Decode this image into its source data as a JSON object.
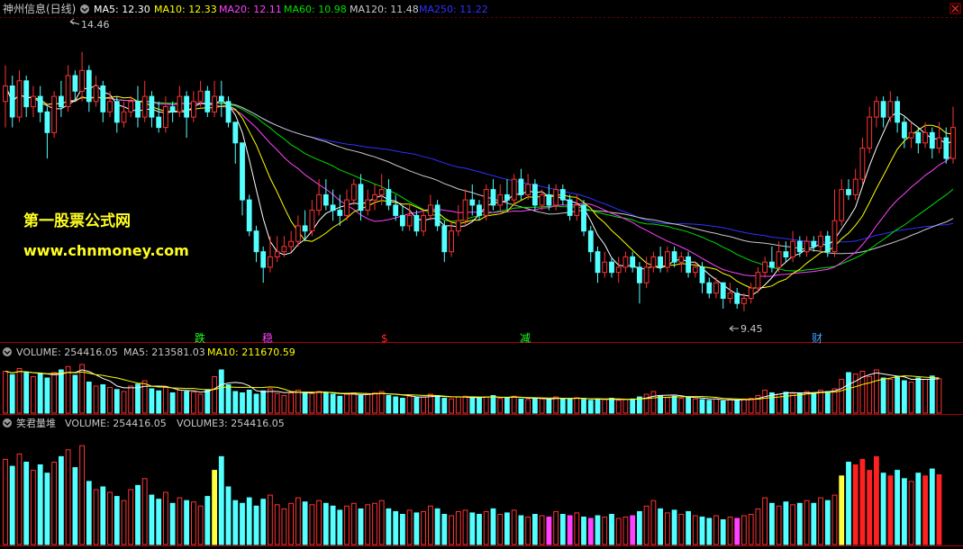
{
  "header": {
    "stock_name": "神州信息(日线)",
    "ma_labels": [
      {
        "text": "MA5: 12.30",
        "color": "#ffffff"
      },
      {
        "text": "MA10: 12.33",
        "color": "#ffff00"
      },
      {
        "text": "MA20: 12.11",
        "color": "#ff40ff"
      },
      {
        "text": "MA60: 10.98",
        "color": "#00e000"
      },
      {
        "text": "MA120: 11.48",
        "color": "#c8c8c8"
      },
      {
        "text": "MA250: 11.22",
        "color": "#3030ff"
      }
    ]
  },
  "price_panel": {
    "high_label": "14.46",
    "low_label": "9.45",
    "watermark_line1": "第一股票公式网",
    "watermark_line2": "www.chnmoney.com",
    "markers": [
      {
        "text": "跌",
        "color": "#20ff20"
      },
      {
        "text": "稳",
        "color": "#ff40ff"
      },
      {
        "text": "$",
        "color": "#ff2020"
      },
      {
        "text": "减",
        "color": "#20ff20"
      },
      {
        "text": "财",
        "color": "#40a0ff"
      }
    ]
  },
  "volume_panel": {
    "label": "VOLUME: 254416.05",
    "ma5_label": "MA5: 213581.03",
    "ma10_label": "MA10: 211670.59"
  },
  "indicator_panel": {
    "label": "笑君量堆",
    "volume_label": "VOLUME: 254416.05",
    "volume3_label": "VOLUME3: 254416.05"
  },
  "colors": {
    "up": "#ff3232",
    "down": "#54ffff",
    "ma5": "#ffffff",
    "ma10": "#ffff00",
    "ma20": "#ff40ff",
    "ma60": "#00e000",
    "ma120": "#c8c8c8",
    "ma250": "#3030ff",
    "axis": "#b00000",
    "yellow_bar": "#ffff40",
    "magenta_bar": "#ff40ff",
    "red_bar": "#ff2020"
  },
  "chart_data": {
    "type": "candlestick",
    "symbol": "神州信息",
    "period": "日线",
    "price_high": 14.46,
    "price_low": 9.45,
    "ylim": [
      9.1,
      14.8
    ],
    "candles": [
      [
        13.5,
        13.8,
        13.0,
        14.2
      ],
      [
        13.8,
        13.2,
        13.0,
        14.0
      ],
      [
        13.2,
        13.9,
        13.1,
        14.1
      ],
      [
        13.9,
        13.4,
        13.2,
        14.0
      ],
      [
        13.4,
        13.6,
        13.2,
        13.8
      ],
      [
        13.6,
        13.3,
        13.1,
        13.8
      ],
      [
        13.3,
        12.9,
        12.4,
        13.4
      ],
      [
        12.9,
        13.6,
        12.8,
        13.7
      ],
      [
        13.6,
        13.4,
        13.2,
        13.9
      ],
      [
        13.4,
        14.0,
        13.3,
        14.2
      ],
      [
        14.0,
        13.7,
        13.5,
        14.1
      ],
      [
        13.7,
        14.1,
        13.5,
        14.46
      ],
      [
        14.1,
        13.5,
        13.3,
        14.2
      ],
      [
        13.5,
        13.8,
        13.4,
        14.0
      ],
      [
        13.8,
        13.3,
        13.1,
        13.9
      ],
      [
        13.3,
        13.5,
        13.2,
        13.7
      ],
      [
        13.5,
        13.1,
        12.9,
        13.6
      ],
      [
        13.1,
        13.3,
        13.0,
        13.5
      ],
      [
        13.3,
        13.5,
        13.2,
        13.6
      ],
      [
        13.5,
        13.2,
        13.0,
        13.8
      ],
      [
        13.2,
        13.6,
        13.1,
        13.9
      ],
      [
        13.6,
        13.2,
        13.0,
        13.7
      ],
      [
        13.2,
        13.0,
        12.9,
        13.5
      ],
      [
        13.0,
        13.4,
        12.9,
        13.6
      ],
      [
        13.4,
        13.3,
        13.1,
        13.5
      ],
      [
        13.3,
        13.6,
        13.2,
        13.8
      ],
      [
        13.6,
        13.2,
        12.8,
        13.7
      ],
      [
        13.2,
        13.5,
        13.1,
        13.7
      ],
      [
        13.5,
        13.7,
        13.4,
        13.9
      ],
      [
        13.7,
        13.3,
        13.2,
        13.8
      ],
      [
        13.3,
        13.6,
        13.2,
        13.9
      ],
      [
        13.6,
        13.5,
        13.2,
        13.9
      ],
      [
        13.5,
        13.1,
        13.0,
        13.6
      ],
      [
        13.1,
        12.7,
        12.3,
        13.1
      ],
      [
        12.7,
        11.6,
        11.3,
        12.7
      ],
      [
        11.6,
        11.0,
        10.9,
        11.7
      ],
      [
        11.0,
        10.6,
        10.4,
        11.1
      ],
      [
        10.6,
        10.3,
        10.0,
        10.7
      ],
      [
        10.3,
        10.5,
        10.2,
        10.9
      ],
      [
        10.5,
        10.6,
        10.4,
        10.9
      ],
      [
        10.6,
        10.7,
        10.5,
        10.9
      ],
      [
        10.7,
        10.8,
        10.6,
        11.0
      ],
      [
        10.8,
        11.1,
        10.7,
        11.3
      ],
      [
        11.1,
        11.0,
        10.8,
        11.4
      ],
      [
        11.0,
        11.4,
        10.9,
        11.6
      ],
      [
        11.4,
        11.7,
        11.3,
        12.0
      ],
      [
        11.7,
        11.5,
        11.4,
        12.0
      ],
      [
        11.5,
        11.4,
        11.2,
        11.8
      ],
      [
        11.4,
        11.3,
        11.1,
        11.7
      ],
      [
        11.3,
        11.6,
        11.2,
        11.8
      ],
      [
        11.6,
        11.9,
        11.5,
        12.0
      ],
      [
        11.9,
        11.4,
        11.2,
        12.1
      ],
      [
        11.4,
        11.6,
        11.3,
        11.8
      ],
      [
        11.6,
        11.7,
        11.4,
        11.9
      ],
      [
        11.7,
        11.8,
        11.5,
        12.1
      ],
      [
        11.8,
        11.5,
        11.4,
        12.0
      ],
      [
        11.5,
        11.3,
        11.2,
        11.7
      ],
      [
        11.3,
        11.1,
        11.0,
        11.5
      ],
      [
        11.1,
        11.3,
        11.0,
        11.5
      ],
      [
        11.3,
        11.0,
        10.9,
        11.4
      ],
      [
        11.0,
        11.3,
        10.9,
        11.4
      ],
      [
        11.3,
        11.5,
        11.2,
        11.7
      ],
      [
        11.5,
        11.1,
        11.0,
        11.6
      ],
      [
        11.1,
        10.6,
        10.4,
        11.2
      ],
      [
        10.6,
        11.0,
        10.5,
        11.2
      ],
      [
        11.0,
        11.2,
        10.9,
        11.5
      ],
      [
        11.2,
        11.6,
        11.1,
        11.8
      ],
      [
        11.6,
        11.5,
        11.3,
        11.9
      ],
      [
        11.5,
        11.3,
        11.2,
        11.6
      ],
      [
        11.3,
        11.8,
        11.2,
        11.9
      ],
      [
        11.8,
        11.5,
        11.4,
        12.0
      ],
      [
        11.5,
        11.7,
        11.4,
        11.9
      ],
      [
        11.7,
        11.6,
        11.4,
        12.0
      ],
      [
        11.6,
        12.0,
        11.5,
        12.1
      ],
      [
        12.0,
        11.7,
        11.6,
        12.2
      ],
      [
        11.7,
        11.9,
        11.6,
        12.1
      ],
      [
        11.9,
        11.5,
        11.4,
        12.0
      ],
      [
        11.5,
        11.7,
        11.4,
        11.8
      ],
      [
        11.7,
        11.5,
        11.4,
        11.9
      ],
      [
        11.5,
        11.8,
        11.4,
        11.9
      ],
      [
        11.8,
        11.6,
        11.5,
        11.9
      ],
      [
        11.6,
        11.3,
        11.2,
        11.7
      ],
      [
        11.3,
        11.5,
        11.2,
        11.7
      ],
      [
        11.5,
        11.0,
        10.9,
        11.6
      ],
      [
        11.0,
        10.6,
        10.4,
        11.1
      ],
      [
        10.6,
        10.2,
        10.0,
        10.7
      ],
      [
        10.2,
        10.4,
        10.1,
        10.6
      ],
      [
        10.4,
        10.2,
        10.1,
        10.5
      ],
      [
        10.2,
        10.3,
        10.0,
        10.5
      ],
      [
        10.3,
        10.5,
        10.2,
        10.6
      ],
      [
        10.5,
        10.3,
        10.2,
        10.6
      ],
      [
        10.3,
        10.0,
        9.6,
        10.4
      ],
      [
        10.0,
        10.3,
        9.9,
        10.5
      ],
      [
        10.3,
        10.5,
        10.2,
        10.6
      ],
      [
        10.5,
        10.3,
        10.2,
        10.7
      ],
      [
        10.3,
        10.6,
        10.2,
        10.7
      ],
      [
        10.6,
        10.4,
        10.3,
        10.7
      ],
      [
        10.4,
        10.5,
        10.2,
        10.6
      ],
      [
        10.5,
        10.2,
        10.1,
        10.6
      ],
      [
        10.2,
        10.3,
        10.1,
        10.4
      ],
      [
        10.3,
        10.0,
        9.8,
        10.4
      ],
      [
        10.0,
        9.8,
        9.7,
        10.1
      ],
      [
        9.8,
        10.0,
        9.7,
        10.1
      ],
      [
        10.0,
        9.7,
        9.5,
        10.0
      ],
      [
        9.7,
        9.8,
        9.6,
        10.0
      ],
      [
        9.8,
        9.6,
        9.5,
        9.9
      ],
      [
        9.6,
        9.7,
        9.45,
        9.8
      ],
      [
        9.7,
        9.9,
        9.6,
        10.0
      ],
      [
        9.9,
        10.2,
        9.8,
        10.3
      ],
      [
        10.2,
        10.4,
        10.1,
        10.5
      ],
      [
        10.4,
        10.3,
        10.2,
        10.7
      ],
      [
        10.3,
        10.6,
        10.2,
        10.8
      ],
      [
        10.6,
        10.5,
        10.4,
        10.8
      ],
      [
        10.5,
        10.8,
        10.4,
        11.0
      ],
      [
        10.8,
        10.6,
        10.5,
        10.9
      ],
      [
        10.6,
        10.8,
        10.5,
        10.9
      ],
      [
        10.8,
        10.7,
        10.6,
        10.9
      ],
      [
        10.7,
        10.9,
        10.6,
        11.0
      ],
      [
        10.9,
        10.6,
        10.5,
        11.0
      ],
      [
        10.6,
        11.2,
        10.5,
        11.8
      ],
      [
        11.2,
        11.8,
        11.1,
        12.0
      ],
      [
        11.8,
        11.7,
        11.6,
        12.0
      ],
      [
        11.7,
        12.0,
        11.6,
        12.2
      ],
      [
        12.0,
        12.6,
        11.9,
        12.8
      ],
      [
        12.6,
        13.2,
        12.5,
        13.4
      ],
      [
        13.2,
        13.5,
        13.0,
        13.6
      ],
      [
        13.5,
        13.2,
        13.0,
        13.6
      ],
      [
        13.2,
        13.5,
        13.1,
        13.7
      ],
      [
        13.5,
        13.1,
        12.9,
        13.6
      ],
      [
        13.1,
        12.8,
        12.6,
        13.2
      ],
      [
        12.8,
        12.9,
        12.6,
        13.1
      ],
      [
        12.9,
        12.7,
        12.5,
        13.0
      ],
      [
        12.7,
        12.9,
        12.6,
        13.1
      ],
      [
        12.9,
        12.6,
        12.4,
        13.0
      ],
      [
        12.6,
        12.8,
        12.5,
        13.1
      ],
      [
        12.8,
        12.4,
        12.3,
        13.0
      ],
      [
        12.4,
        13.0,
        12.3,
        13.4
      ]
    ],
    "volume": [
      310,
      285,
      330,
      300,
      270,
      290,
      260,
      300,
      320,
      345,
      280,
      360,
      230,
      200,
      210,
      190,
      175,
      160,
      200,
      215,
      240,
      180,
      165,
      190,
      150,
      170,
      160,
      155,
      140,
      175,
      270,
      320,
      210,
      160,
      150,
      170,
      140,
      165,
      180,
      145,
      130,
      150,
      170,
      155,
      145,
      160,
      150,
      140,
      125,
      140,
      150,
      130,
      145,
      150,
      160,
      130,
      120,
      110,
      125,
      115,
      120,
      140,
      130,
      110,
      105,
      120,
      125,
      115,
      110,
      120,
      130,
      110,
      115,
      125,
      105,
      100,
      110,
      105,
      100,
      120,
      110,
      105,
      115,
      100,
      95,
      105,
      100,
      110,
      95,
      100,
      105,
      120,
      140,
      160,
      130,
      115,
      125,
      110,
      120,
      105,
      100,
      95,
      105,
      90,
      100,
      95,
      105,
      110,
      130,
      170,
      150,
      140,
      155,
      145,
      150,
      160,
      150,
      170,
      160,
      180,
      250,
      300,
      290,
      310,
      270,
      320,
      260,
      250,
      270,
      240,
      230,
      260,
      250,
      275,
      254
    ]
  }
}
